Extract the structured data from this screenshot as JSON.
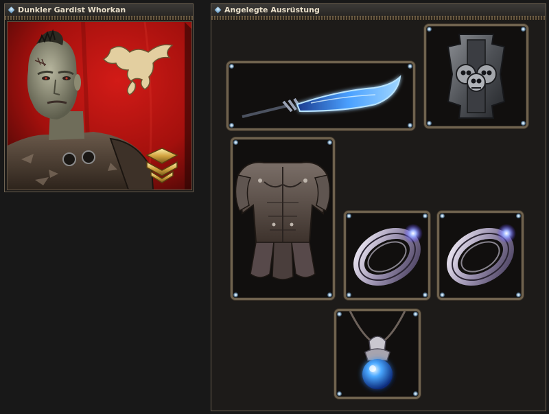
{
  "character_panel": {
    "title": "Dunkler Gardist Whorkan",
    "portrait_icon": "warrior-portrait",
    "banner_color": "#b1120f",
    "emblem_icon": "dragon-emblem",
    "rank_icon": "gold-rank-chevron-icon"
  },
  "equipment_panel": {
    "title": "Angelegte Ausrüstung",
    "slots": [
      {
        "item_icon": "glowing-blue-scimitar-icon"
      },
      {
        "item_icon": "skull-shield-icon"
      },
      {
        "item_icon": "leather-armor-icon"
      },
      {
        "item_icon": "silver-ring-icon"
      },
      {
        "item_icon": "silver-ring-icon"
      },
      {
        "item_icon": "blue-orb-amulet-icon"
      }
    ]
  },
  "colors": {
    "panel_border": "#6e6252",
    "title_text": "#e9dfca",
    "weapon_glow": "#3f8cff"
  }
}
